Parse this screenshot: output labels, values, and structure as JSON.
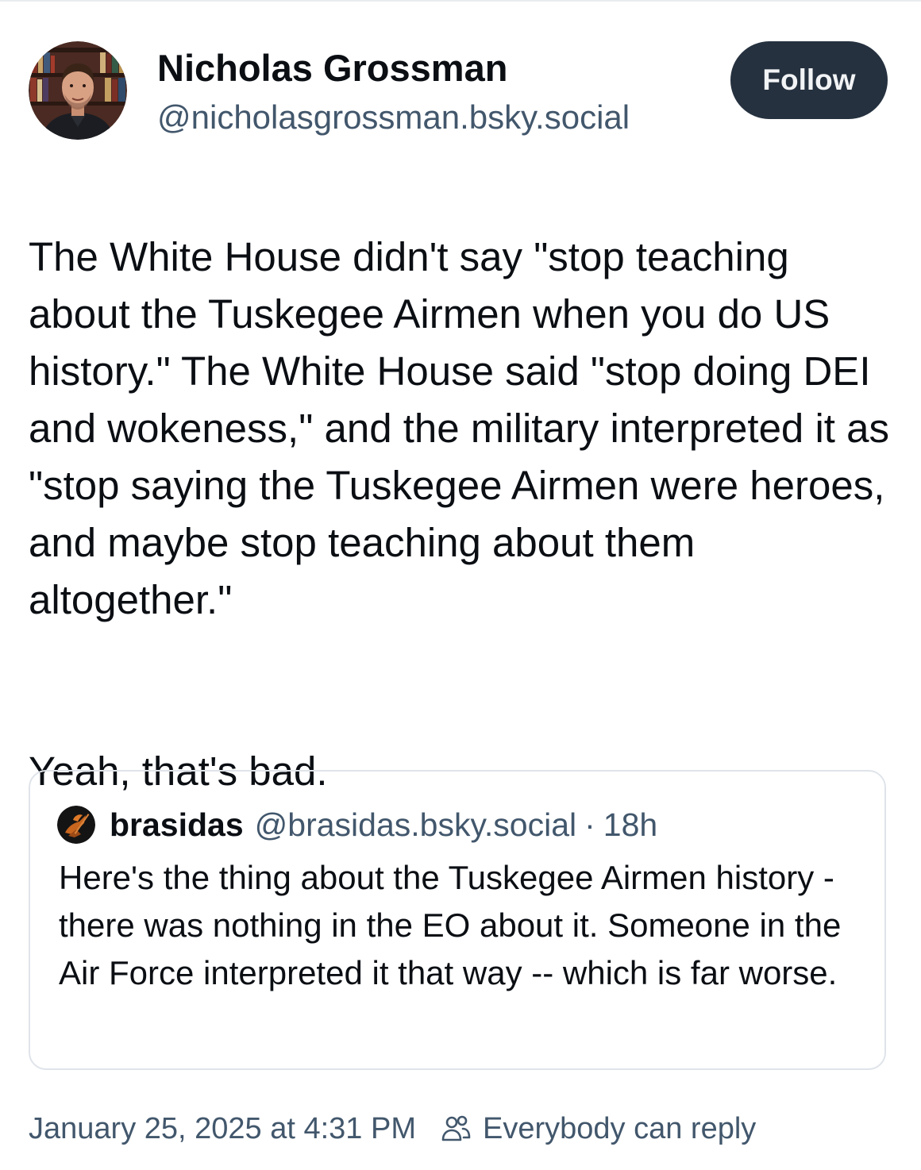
{
  "author": {
    "name": "Nicholas Grossman",
    "handle": "@nicholasgrossman.bsky.social",
    "avatar_icon": "profile-photo"
  },
  "follow_button": {
    "label": "Follow",
    "color": "#25313f"
  },
  "post": {
    "paragraphs": [
      "The White House didn't say \"stop teaching about the Tuskegee Airmen when you do US history.\" The White House said \"stop doing DEI and wokeness,\" and the military interpreted it as \"stop saying the Tuskegee Airmen were heroes, and maybe stop teaching about them altogether.\"",
      "Yeah, that's bad."
    ]
  },
  "quote": {
    "name": "brasidas",
    "handle": "@brasidas.bsky.social",
    "separator": "·",
    "time": "18h",
    "text": "Here's the thing about the Tuskegee Airmen history - there was nothing in the EO about it. Someone in the Air Force interpreted it that way -- which is far worse.",
    "avatar_icon": "spartan-warrior-avatar"
  },
  "footer": {
    "timestamp": "January 25, 2025 at 4:31 PM",
    "reply_setting": "Everybody can reply",
    "reply_icon": "people-icon"
  },
  "colors": {
    "text": "#0b0f14",
    "secondary": "#42576c",
    "border": "#dfe4ea"
  }
}
